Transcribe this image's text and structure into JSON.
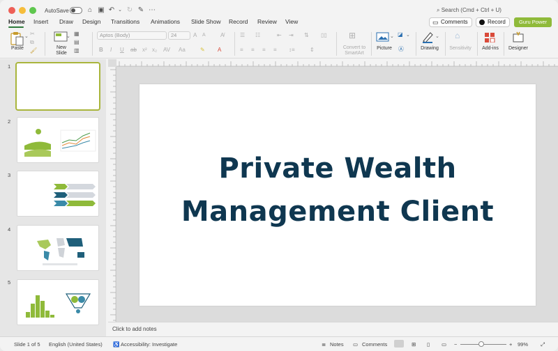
{
  "titlebar": {
    "autosave_label": "AutoSave",
    "search_placeholder": "Search (Cmd + Ctrl + U)"
  },
  "tabs": [
    {
      "label": "Home",
      "active": true
    },
    {
      "label": "Insert"
    },
    {
      "label": "Draw"
    },
    {
      "label": "Design"
    },
    {
      "label": "Transitions"
    },
    {
      "label": "Animations"
    },
    {
      "label": "Slide Show"
    },
    {
      "label": "Record"
    },
    {
      "label": "Review"
    },
    {
      "label": "View"
    }
  ],
  "header_buttons": {
    "comments": "Comments",
    "record": "Record",
    "guru": "Guru Power"
  },
  "ribbon": {
    "paste": "Paste",
    "new_slide_line1": "New",
    "new_slide_line2": "Slide",
    "font_name": "Aptos (Body)",
    "font_size": "24",
    "convert_line1": "Convert to",
    "convert_line2": "SmartArt",
    "picture": "Picture",
    "drawing": "Drawing",
    "sensitivity": "Sensitivity",
    "addins": "Add-ins",
    "designer": "Designer"
  },
  "thumbnails": [
    {
      "number": "1"
    },
    {
      "number": "2"
    },
    {
      "number": "3"
    },
    {
      "number": "4"
    },
    {
      "number": "5"
    }
  ],
  "slide": {
    "title_line1": "Private Wealth",
    "title_line2": "Management Client"
  },
  "notes_placeholder": "Click to add notes",
  "status": {
    "slide_counter": "Slide 1 of 5",
    "language": "English (United States)",
    "accessibility": "Accessibility: Investigate",
    "notes": "Notes",
    "comments": "Comments",
    "zoom": "99%"
  },
  "colors": {
    "accent_green": "#8fba3a",
    "title_navy": "#0f3750",
    "selection_border": "#a9b53c"
  }
}
